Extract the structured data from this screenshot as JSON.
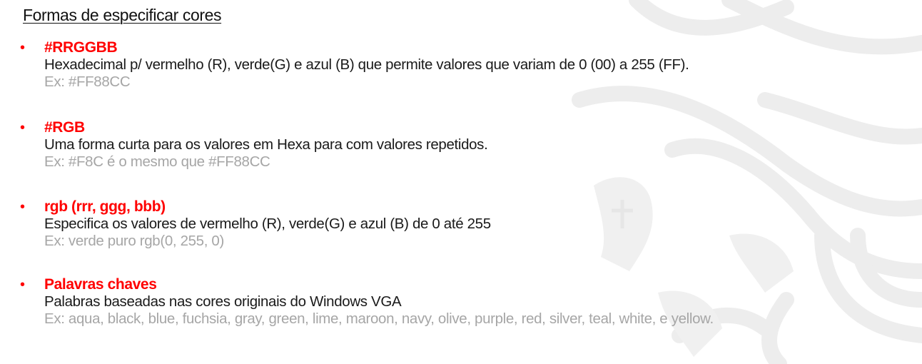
{
  "title": "Formas de especificar cores",
  "items": [
    {
      "heading": "#RRGGBB",
      "description": "Hexadecimal p/ vermelho (R), verde(G) e azul (B) que permite valores que variam de 0 (00) a 255 (FF).",
      "example": "Ex: #FF88CC"
    },
    {
      "heading": "#RGB",
      "description": "Uma forma curta para os valores em Hexa para com valores repetidos.",
      "example": "Ex: #F8C é o mesmo que #FF88CC"
    },
    {
      "heading": "rgb (rrr, ggg, bbb)",
      "description": "Especifica os valores de vermelho (R), verde(G) e azul (B) de 0 até 255",
      "example": "Ex: verde puro rgb(0, 255, 0)"
    },
    {
      "heading": "Palavras chaves",
      "description": "Palabras baseadas nas cores originais do Windows VGA",
      "example": "Ex: aqua, black, blue, fuchsia, gray, green, lime, maroon, navy, olive, purple, red, silver, teal, white, e yellow."
    }
  ],
  "colors": {
    "heading": "#ff0000",
    "text": "#1a1a1a",
    "example": "#a6a6a6",
    "watermark": "#ececec"
  }
}
